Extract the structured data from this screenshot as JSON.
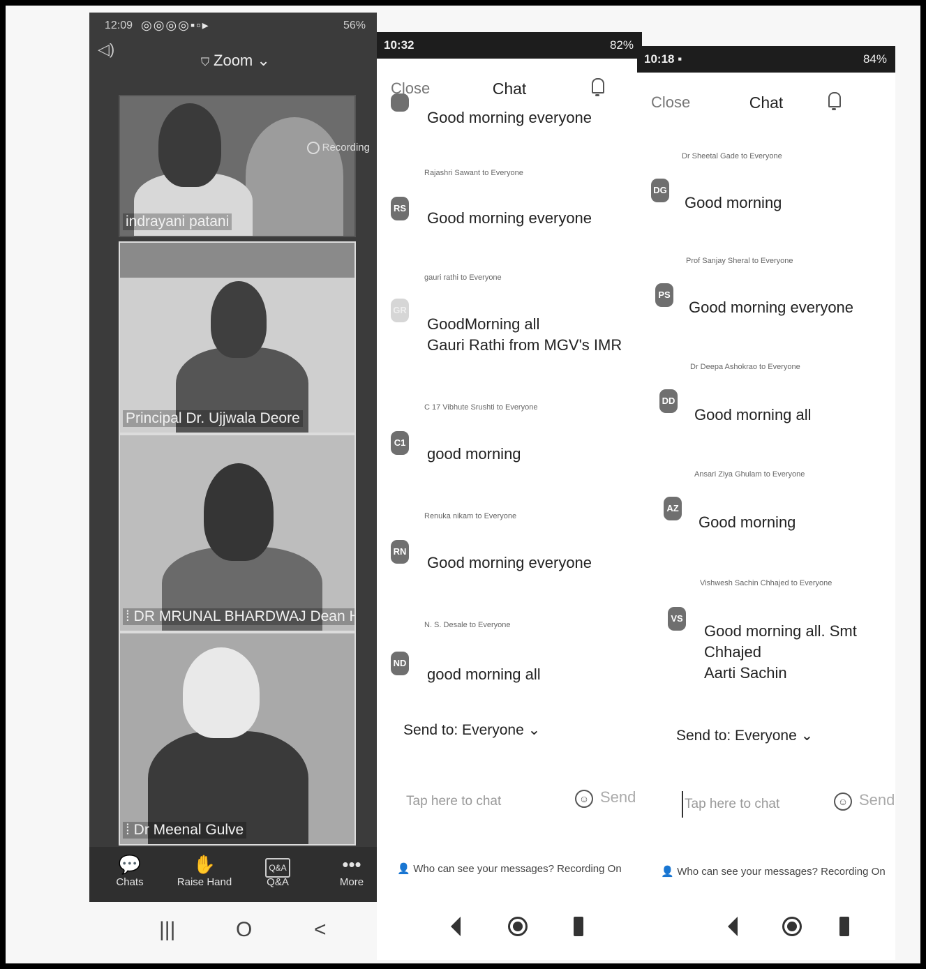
{
  "meeting": {
    "status_time": "12:09",
    "status_icons": "◎◎◎◎▪▫▸",
    "status_right": "56%",
    "app_title": "Zoom",
    "recording_label": "Recording",
    "tiles": [
      {
        "name": "indrayani patani"
      },
      {
        "name": "Principal  Dr. Ujjwala Deore"
      },
      {
        "name": "DR MRUNAL BHARDWAJ Dean Hum..."
      },
      {
        "name": "Dr Meenal Gulve"
      }
    ],
    "toolbar": {
      "chats": "Chats",
      "raise_hand": "Raise Hand",
      "qa": "Q&A",
      "qa_icon_text": "Q&A",
      "more": "More"
    },
    "nav": {
      "recent": "|||",
      "home": "O",
      "back": "<"
    }
  },
  "chat_left": {
    "status_time": "10:32",
    "status_right": "82%",
    "close": "Close",
    "title": "Chat",
    "partial_message": "Good morning everyone",
    "messages": [
      {
        "sender": "Rajashri Sawant to Everyone",
        "initials": "RS",
        "text": "Good morning  everyone"
      },
      {
        "sender": "gauri rathi to Everyone",
        "initials": "GR",
        "text": "GoodMorning all\nGauri Rathi from MGV's IMR"
      },
      {
        "sender": "C 17 Vibhute Srushti to Everyone",
        "initials": "C1",
        "text": "good morning"
      },
      {
        "sender": "Renuka nikam to Everyone",
        "initials": "RN",
        "text": "Good morning everyone"
      },
      {
        "sender": "N. S. Desale to Everyone",
        "initials": "ND",
        "text": "good morning all"
      }
    ],
    "send_to": "Send to: Everyone",
    "input_placeholder": "Tap here to chat",
    "send": "Send",
    "who_can_see": "Who can see your messages? Recording On"
  },
  "chat_right": {
    "status_time": "10:18",
    "status_right": "84%",
    "close": "Close",
    "title": "Chat",
    "messages": [
      {
        "sender": "Dr Sheetal Gade to Everyone",
        "initials": "DG",
        "text": "Good morning"
      },
      {
        "sender": "Prof Sanjay Sheral to Everyone",
        "initials": "PS",
        "text": "Good morning everyone"
      },
      {
        "sender": "Dr Deepa Ashokrao to Everyone",
        "initials": "DD",
        "text": "Good morning all"
      },
      {
        "sender": "Ansari Ziya Ghulam to Everyone",
        "initials": "AZ",
        "text": "Good morning"
      },
      {
        "sender": "Vishwesh Sachin Chhajed to Everyone",
        "initials": "VS",
        "text": "Good morning all. Smt Chhajed\nAarti Sachin"
      }
    ],
    "send_to": "Send to: Everyone",
    "input_placeholder": "Tap here to chat",
    "send": "Send",
    "who_can_see": "Who can see your messages? Recording On"
  }
}
